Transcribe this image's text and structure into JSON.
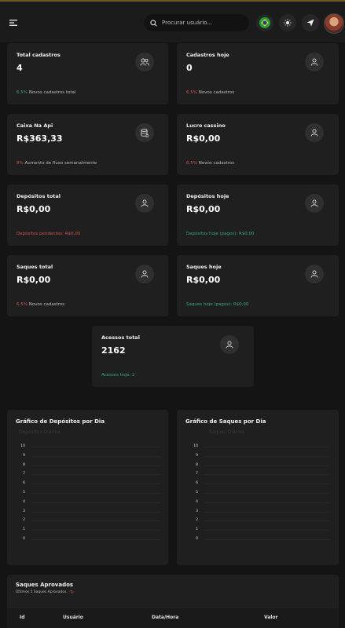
{
  "search": {
    "placeholder": "Procurar usuário..."
  },
  "stats": {
    "total_cadastros": {
      "title": "Total cadastros",
      "value": "4",
      "foot_pct": "6.5%",
      "foot_text": "Novos cadastros total"
    },
    "cadastros_hoje": {
      "title": "Cadastros hoje",
      "value": "0",
      "foot_pct": "6.5%",
      "foot_text": "Novos cadastros"
    },
    "caixa_api": {
      "title": "Caixa Na Api",
      "value": "R$363,33",
      "foot_pct": "8%",
      "foot_text": "Aumento de fluxo semanalmente"
    },
    "lucro_cassino": {
      "title": "Lucro cassino",
      "value": "R$0,00",
      "foot_pct": "6.5%",
      "foot_text": "Novos cadastros"
    },
    "depositos_total": {
      "title": "Depósitos total",
      "value": "R$0,00",
      "foot_text": "Depósitos pendentes: R$0,00"
    },
    "depositos_hoje": {
      "title": "Depósitos hoje",
      "value": "R$0,00",
      "foot_text": "Depósitos hoje (pagos): R$0,00"
    },
    "saques_total": {
      "title": "Saques total",
      "value": "R$0,00",
      "foot_pct": "6.5%",
      "foot_text": "Novos cadastros"
    },
    "saques_hoje": {
      "title": "Saques hoje",
      "value": "R$0,00",
      "foot_text": "Saques hoje (pagos): R$0,00"
    },
    "acessos_total": {
      "title": "Acessos total",
      "value": "2162",
      "foot_text": "Acessos hoje: 2"
    }
  },
  "charts": {
    "depositos": {
      "title": "Gráfico de Depósitos por Dia",
      "legend": "Depósitos Diários"
    },
    "saques": {
      "title": "Gráfico de Saques por Dia",
      "legend": "Saques Diários"
    }
  },
  "chart_data": [
    {
      "type": "line",
      "title": "Gráfico de Depósitos por Dia",
      "series": [
        {
          "name": "Depósitos Diários",
          "values": []
        }
      ],
      "yticks": [
        "10",
        "9",
        "8",
        "7",
        "6",
        "5",
        "4",
        "3",
        "2",
        "1",
        "0"
      ],
      "ylim": [
        0,
        10
      ]
    },
    {
      "type": "line",
      "title": "Gráfico de Saques por Dia",
      "series": [
        {
          "name": "Saques Diários",
          "values": []
        }
      ],
      "yticks": [
        "10",
        "9",
        "8",
        "7",
        "6",
        "5",
        "4",
        "3",
        "2",
        "1",
        "0"
      ],
      "ylim": [
        0,
        10
      ]
    }
  ],
  "saques_aprovados": {
    "title": "Saques Aprovados",
    "subtitle": "Últimos 5 Saques Aprovados.",
    "columns": [
      "Id",
      "Usuário",
      "Data/Hora",
      "Valor"
    ]
  },
  "colors": {
    "accent_green": "#3aa58e",
    "accent_red": "#d0554e",
    "card_bg": "#1f1f1f"
  }
}
